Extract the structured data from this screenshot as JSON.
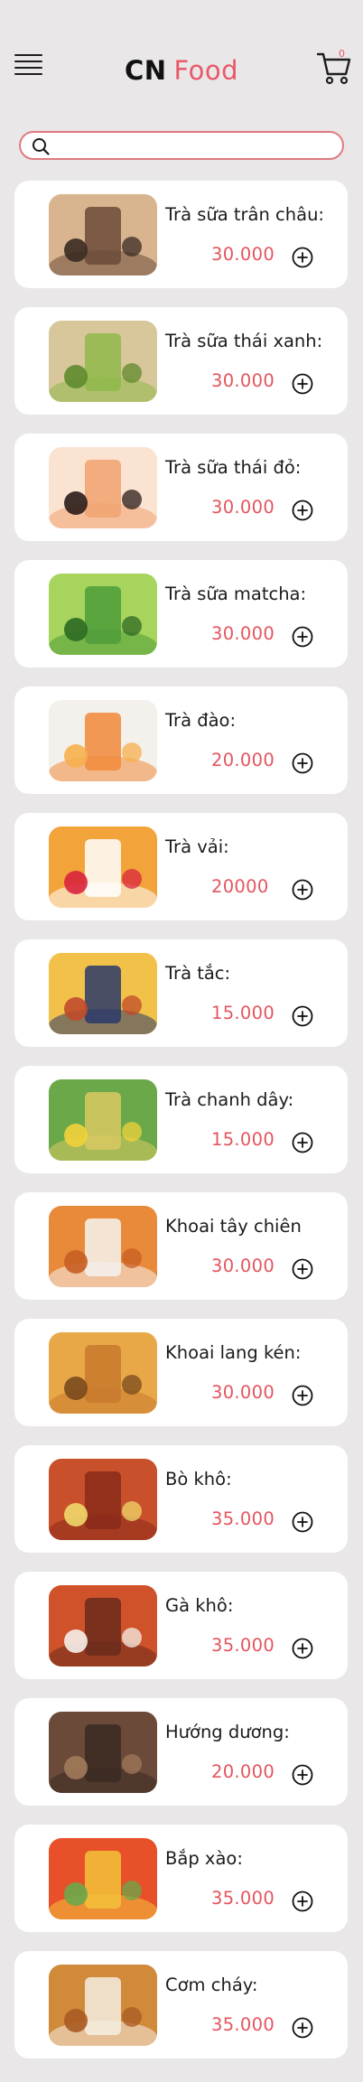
{
  "header": {
    "brand_cn": "CN",
    "brand_food": "Food",
    "cart_count": "0",
    "menu_icon": "hamburger-menu-icon",
    "cart_icon": "shopping-cart-icon"
  },
  "search": {
    "placeholder": "",
    "value": "",
    "icon": "search-icon"
  },
  "colors": {
    "accent": "#e8596a",
    "price": "#e4555e",
    "background": "#e9e7e7",
    "card": "#ffffff"
  },
  "products": [
    {
      "name": "Trà sữa trân châu:",
      "price": "30.000",
      "add_icon": "plus-circle-icon"
    },
    {
      "name": "Trà sữa thái xanh:",
      "price": "30.000",
      "add_icon": "plus-circle-icon"
    },
    {
      "name": "Trà sữa thái đỏ:",
      "price": "30.000",
      "add_icon": "plus-circle-icon"
    },
    {
      "name": "Trà sữa matcha:",
      "price": "30.000",
      "add_icon": "plus-circle-icon"
    },
    {
      "name": "Trà đào:",
      "price": "20.000",
      "add_icon": "plus-circle-icon"
    },
    {
      "name": "Trà vải:",
      "price": "20000",
      "add_icon": "plus-circle-icon"
    },
    {
      "name": "Trà tắc:",
      "price": "15.000",
      "add_icon": "plus-circle-icon"
    },
    {
      "name": "Trà chanh dây:",
      "price": "15.000",
      "add_icon": "plus-circle-icon"
    },
    {
      "name": "Khoai tây chiên",
      "price": "30.000",
      "add_icon": "plus-circle-icon"
    },
    {
      "name": "Khoai lang kén:",
      "price": "30.000",
      "add_icon": "plus-circle-icon"
    },
    {
      "name": "Bò khô:",
      "price": "35.000",
      "add_icon": "plus-circle-icon"
    },
    {
      "name": "Gà khô:",
      "price": "35.000",
      "add_icon": "plus-circle-icon"
    },
    {
      "name": "Hướng dương:",
      "price": "20.000",
      "add_icon": "plus-circle-icon"
    },
    {
      "name": "Bắp xào:",
      "price": "35.000",
      "add_icon": "plus-circle-icon"
    },
    {
      "name": "Cơm cháy:",
      "price": "35.000",
      "add_icon": "plus-circle-icon"
    }
  ]
}
